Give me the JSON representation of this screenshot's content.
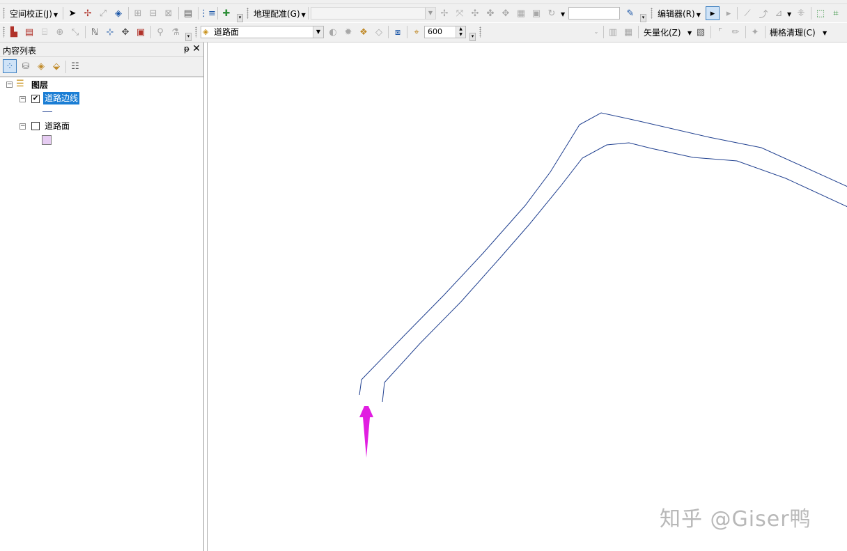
{
  "toolbar1": {
    "spatial_adjust_label": "空间校正(J)",
    "georef_label": "地理配准(G)",
    "editor_label": "编辑器(R)"
  },
  "toolbar2": {
    "target_layer": "道路面",
    "scale_value": "600",
    "vectorize_label": "矢量化(Z)",
    "raster_cleanup_label": "栅格清理(C)"
  },
  "toc": {
    "title": "内容列表",
    "root_label": "图层",
    "layers": [
      {
        "name": "道路边线",
        "checked": true,
        "symbol": "line"
      },
      {
        "name": "道路面",
        "checked": false,
        "symbol": "fill",
        "fill_color": "#e6ccf2"
      }
    ]
  },
  "map": {
    "line_color": "#1f3f8f",
    "arrow_color": "#e11ee1",
    "watermark": "知乎 @Giser鸭"
  }
}
